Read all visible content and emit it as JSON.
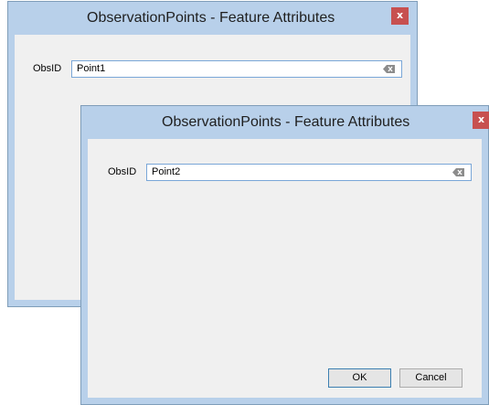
{
  "dialogs": [
    {
      "title": "ObservationPoints - Feature Attributes",
      "close_label": "x",
      "field_label": "ObsID",
      "field_value": "Point1"
    },
    {
      "title": "ObservationPoints - Feature Attributes",
      "close_label": "x",
      "field_label": "ObsID",
      "field_value": "Point2",
      "ok_label": "OK",
      "cancel_label": "Cancel"
    }
  ],
  "colors": {
    "frame": "#b8d0ea",
    "client": "#f0f0f0",
    "close_button": "#c75050",
    "field_border": "#7aa7d8"
  },
  "icons": {
    "clear_field": "clear-text-icon",
    "close": "close-icon"
  }
}
